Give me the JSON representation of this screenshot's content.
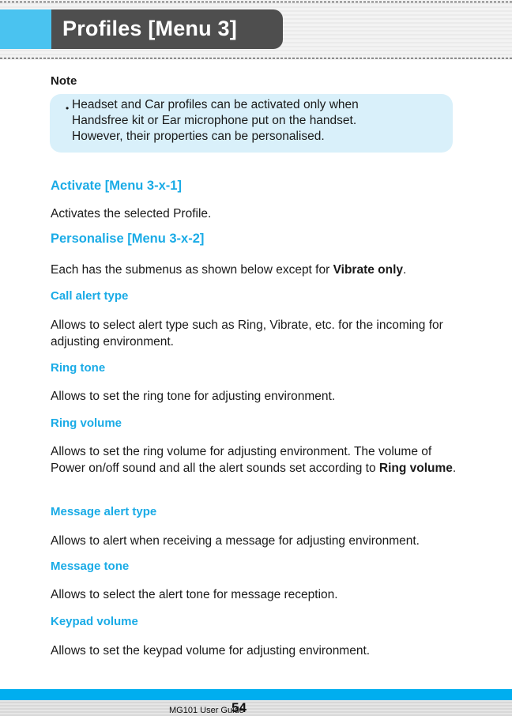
{
  "header": {
    "title": "Profiles [Menu 3]"
  },
  "note": {
    "label": "Note",
    "bullet": "•",
    "text": "Headset and Car profiles can be activated only when\nHandsfree kit or Ear microphone put on the handset.\nHowever, their properties can be personalised."
  },
  "sections": {
    "activate": {
      "heading": "Activate [Menu 3-x-1]",
      "body": "Activates the selected Profile."
    },
    "personalise": {
      "heading": "Personalise [Menu 3-x-2]",
      "body_pre": "Each has the submenus as shown below except for ",
      "body_bold": "Vibrate only",
      "body_post": "."
    }
  },
  "submenus": {
    "call_alert_type": {
      "heading": "Call alert type",
      "body": "Allows to select alert type such as Ring, Vibrate, etc. for the incoming for adjusting environment."
    },
    "ring_tone": {
      "heading": "Ring tone",
      "body": "Allows to set the ring tone for adjusting environment."
    },
    "ring_volume": {
      "heading": "Ring volume",
      "body_pre": "Allows to set the ring volume for adjusting environment. The volume of Power on/off sound and all the alert sounds set according to ",
      "body_bold": "Ring volume",
      "body_post": "."
    },
    "message_alert_type": {
      "heading": "Message alert type",
      "body": "Allows to alert when receiving a message for adjusting environment."
    },
    "message_tone": {
      "heading": "Message tone",
      "body": "Allows to select the alert tone for message reception."
    },
    "keypad_volume": {
      "heading": "Keypad volume",
      "body": "Allows to set the keypad volume for adjusting environment."
    }
  },
  "footer": {
    "guide": "MG101 User Guide",
    "page": "54"
  },
  "colors": {
    "accent": "#1aabe6",
    "header_dark": "#4e4e4e",
    "header_blue": "#4ac3f0",
    "note_bg": "#d9f0fa",
    "footer_blue": "#00aeef"
  }
}
